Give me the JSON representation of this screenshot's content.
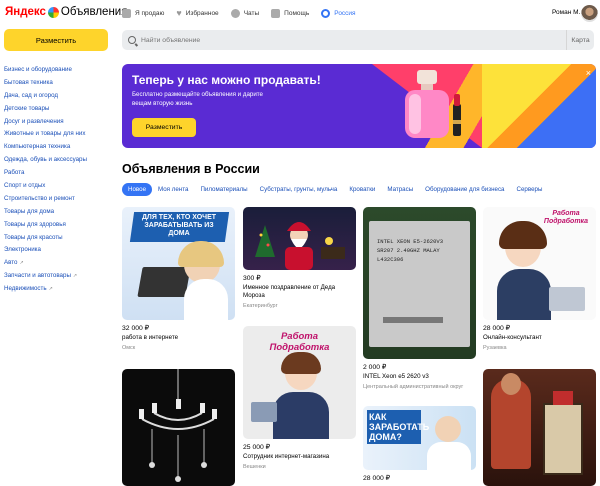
{
  "header": {
    "logo_brand": "Яндекс",
    "logo_product": "Объявления",
    "nav": [
      {
        "label": "Я продаю",
        "icon": "tag-icon"
      },
      {
        "label": "Избранное",
        "icon": "heart-icon"
      },
      {
        "label": "Чаты",
        "icon": "chat-icon"
      },
      {
        "label": "Помощь",
        "icon": "help-icon"
      },
      {
        "label": "Россия",
        "icon": "location-icon"
      }
    ],
    "user_name": "Роман М."
  },
  "sidebar": {
    "place_button": "Разместить",
    "categories": [
      "Бизнес и оборудование",
      "Бытовая техника",
      "Дача, сад и огород",
      "Детские товары",
      "Досуг и развлечения",
      "Животные и товары для них",
      "Компьютерная техника",
      "Одежда, обувь и аксессуары",
      "Работа",
      "Спорт и отдых",
      "Строительство и ремонт",
      "Товары для дома",
      "Товары для здоровья",
      "Товары для красоты",
      "Электроника",
      "Авто",
      "Запчасти и автотовары",
      "Недвижимость"
    ],
    "external_marker": "↗"
  },
  "search": {
    "placeholder": "Найти объявление",
    "map_label": "Карта"
  },
  "banner": {
    "title": "Теперь у нас можно продавать!",
    "text": "Бесплатно размещайте объявления и дарите вещам вторую жизнь",
    "button": "Разместить",
    "close": "×"
  },
  "feed": {
    "title": "Объявления в России",
    "chips": [
      "Новое",
      "Моя лента",
      "Пиломатериалы",
      "Субстраты, грунты, мульча",
      "Кроватки",
      "Матрасы",
      "Оборудование для бизнеса",
      "Серверы"
    ],
    "cards": [
      {
        "price": "32 000 ₽",
        "title": "работа в интернете",
        "place": "Омск",
        "img_text": "ДЛЯ ТЕХ, КТО ХОЧЕТ ЗАРАБАТЫВАТЬ ИЗ ДОМА"
      },
      {
        "price": "300 ₽",
        "title": "Именное поздравление от Деда Мороза",
        "place": "Екатеринбург",
        "img_text": ""
      },
      {
        "price": "2 000 ₽",
        "title": "INTEL Xeon e5 2620 v3",
        "place": "Центральный административный округ",
        "img_text": "INTEL XEON E5-2620V3 SR207 2.40GHZ MALAY L432C306"
      },
      {
        "price": "28 000 ₽",
        "title": "Онлайн-консультант",
        "place": "Рузаевка",
        "img_text": "Работа Подработка"
      },
      {
        "price": "",
        "title": "",
        "place": "",
        "img_text": ""
      },
      {
        "price": "25 000 ₽",
        "title": "Сотрудник интернет-магазина",
        "place": "Вешенки",
        "img_text": "Работа Подработка"
      },
      {
        "price": "28 000 ₽",
        "title": "",
        "place": "",
        "img_text": "КАК ЗАРАБОТАТЬ ДОМА?"
      },
      {
        "price": "",
        "title": "",
        "place": "",
        "img_text": ""
      }
    ]
  },
  "colors": {
    "accent_yellow": "#fed42b",
    "link_blue": "#1a4fb8",
    "chip_blue": "#3474f4",
    "banner_purple": "#5a2bd3"
  }
}
